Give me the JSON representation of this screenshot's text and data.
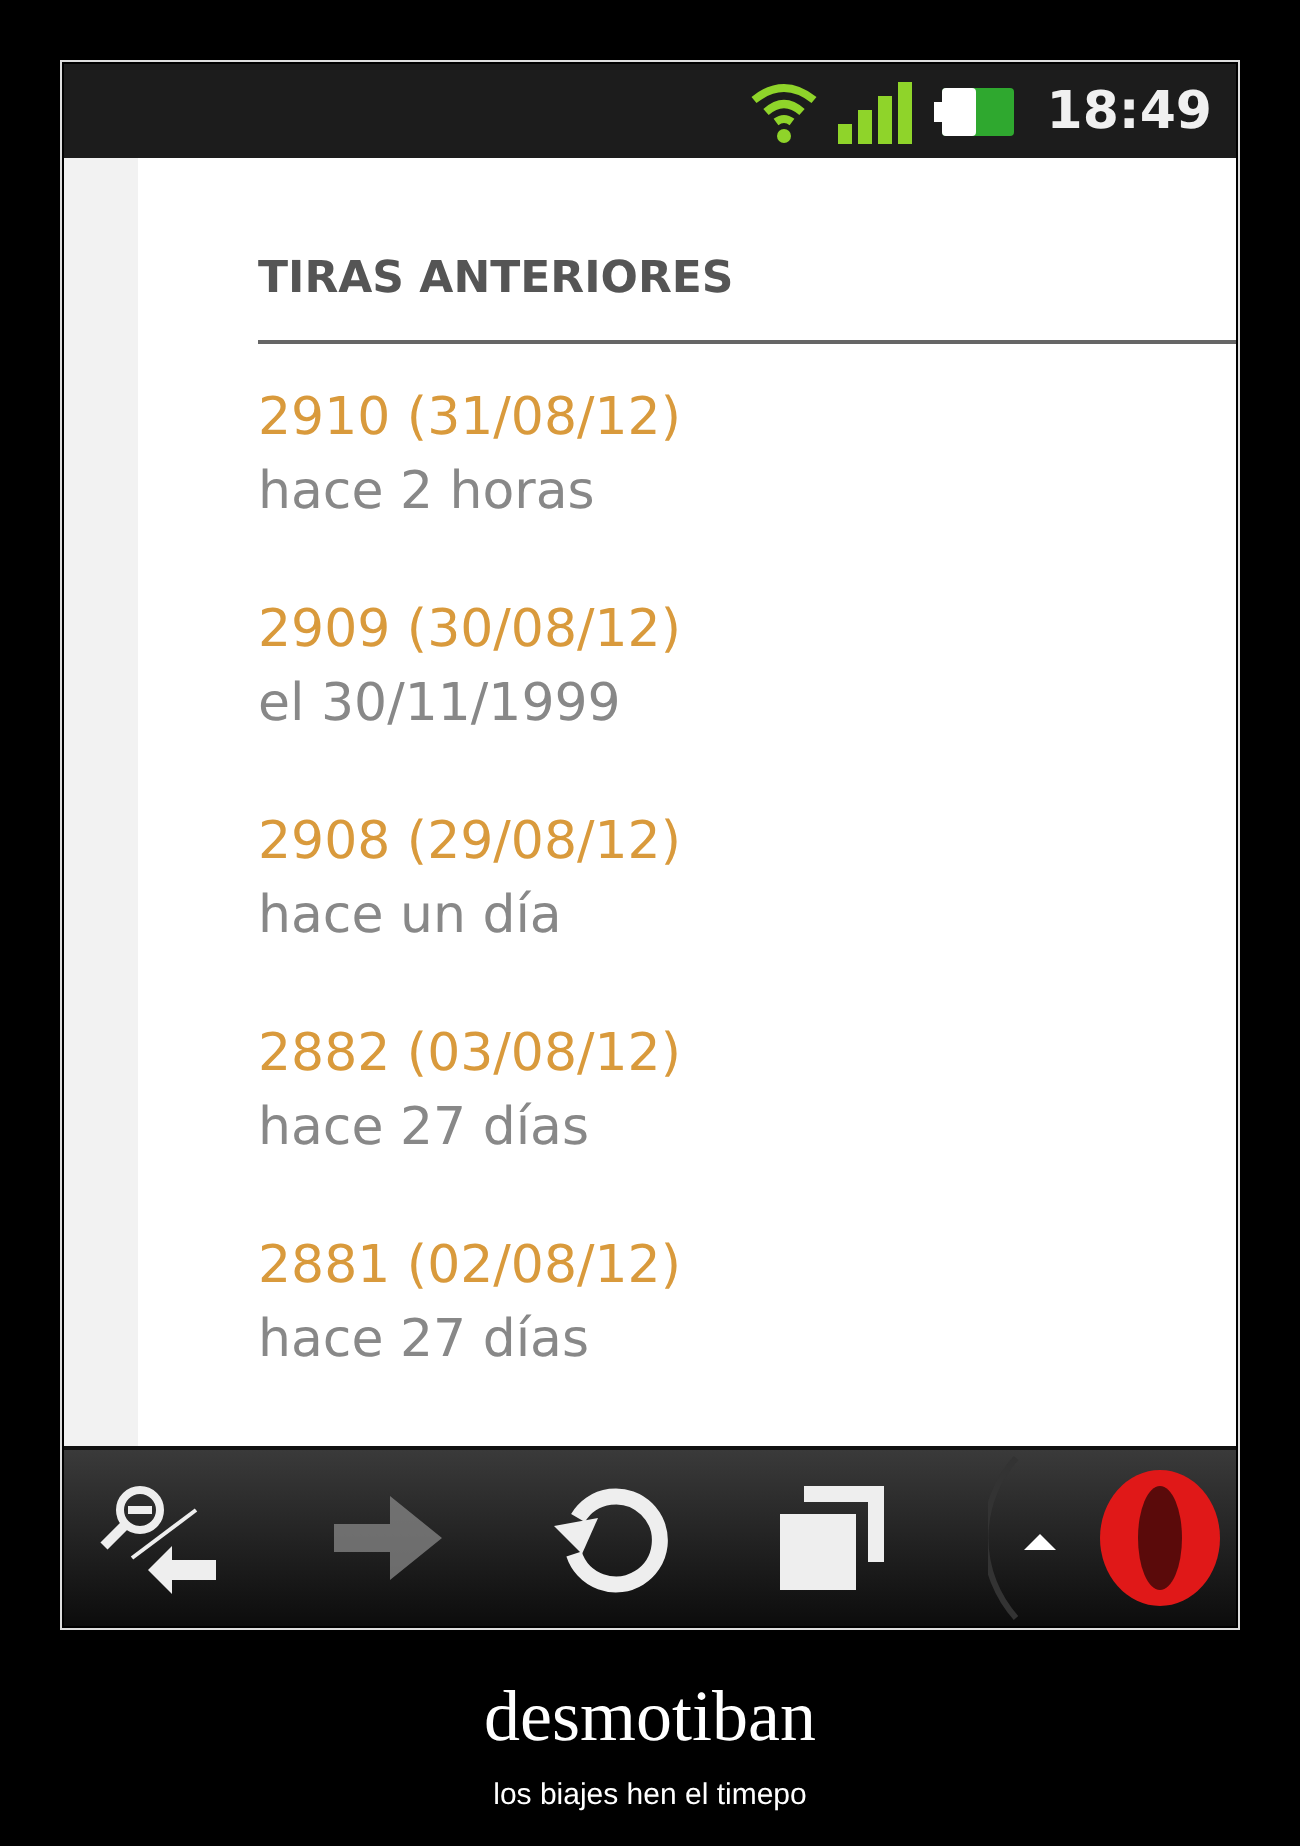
{
  "status_bar": {
    "time": "18:49"
  },
  "page": {
    "heading": "TIRAS ANTERIORES",
    "items": [
      {
        "title": "2910 (31/08/12)",
        "when": "hace 2 horas"
      },
      {
        "title": "2909 (30/08/12)",
        "when": "el 30/11/1999"
      },
      {
        "title": "2908 (29/08/12)",
        "when": "hace un día"
      },
      {
        "title": "2882 (03/08/12)",
        "when": "hace 27 días"
      },
      {
        "title": "2881 (02/08/12)",
        "when": "hace 27 días"
      }
    ]
  },
  "toolbar": [
    {
      "kind": "zoom-back",
      "disabled": false
    },
    {
      "kind": "forward",
      "disabled": true
    },
    {
      "kind": "reload",
      "disabled": false
    },
    {
      "kind": "tabs",
      "disabled": false
    },
    {
      "kind": "menu",
      "disabled": false
    }
  ],
  "caption": {
    "title": "desmotiban",
    "subtitle": "los biajes hen el timepo"
  }
}
